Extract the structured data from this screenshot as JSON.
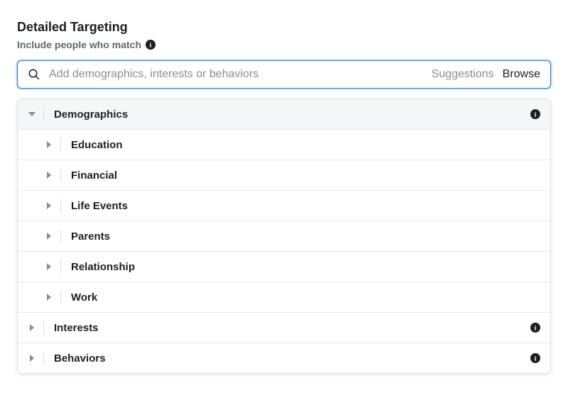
{
  "section": {
    "title": "Detailed Targeting",
    "subtitle": "Include people who match"
  },
  "search": {
    "placeholder": "Add demographics, interests or behaviors",
    "suggestions": "Suggestions",
    "browse": "Browse"
  },
  "categories": [
    {
      "label": "Demographics",
      "expanded": true,
      "subcategories": [
        {
          "label": "Education"
        },
        {
          "label": "Financial"
        },
        {
          "label": "Life Events"
        },
        {
          "label": "Parents"
        },
        {
          "label": "Relationship"
        },
        {
          "label": "Work"
        }
      ]
    },
    {
      "label": "Interests",
      "expanded": false
    },
    {
      "label": "Behaviors",
      "expanded": false
    }
  ]
}
